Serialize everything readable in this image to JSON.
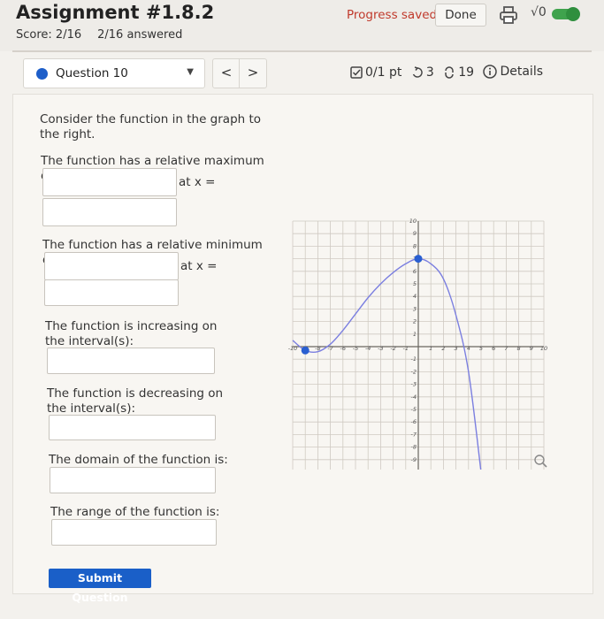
{
  "header": {
    "title": "Assignment #1.8.2",
    "score": "Score: 2/16",
    "answered": "2/16 answered",
    "progress_status": "Progress saved",
    "done_label": "Done",
    "sqrt_label": "√0"
  },
  "question_bar": {
    "question_label": "Question 10",
    "prev": "<",
    "next": ">",
    "points": "0/1 pt",
    "retries": "3",
    "attempts": "19",
    "details": "Details"
  },
  "question": {
    "intro": "Consider the function in the graph to the right.",
    "max_prompt": "The function has a relative maximum of",
    "max_at": "at x =",
    "min_prompt": "The function has a relative minimum of",
    "min_at": "at x =",
    "increasing_prompt": "The function is increasing on the interval(s):",
    "decreasing_prompt": "The function is decreasing on the interval(s):",
    "domain_prompt": "The domain of the function is:",
    "range_prompt": "The range of the function is:",
    "submit_label": "Submit Question"
  },
  "graph": {
    "x_range": [
      -10,
      10
    ],
    "y_range": [
      -10,
      10
    ],
    "x_ticks": [
      "-10",
      "-9",
      "-8",
      "-7",
      "-6",
      "-5",
      "-4",
      "-3",
      "-2",
      "-1",
      "1",
      "2",
      "3",
      "4",
      "5",
      "6",
      "7",
      "8",
      "9",
      "10"
    ],
    "y_ticks": [
      "10",
      "9",
      "8",
      "7",
      "6",
      "5",
      "4",
      "3",
      "2",
      "1",
      "-1",
      "-2",
      "-3",
      "-4",
      "-5",
      "-6",
      "-7",
      "-8",
      "-9",
      "-10"
    ],
    "curve_points": [
      [
        -10,
        0.5
      ],
      [
        -9,
        -0.3
      ],
      [
        -8,
        -0.4
      ],
      [
        -7,
        0.2
      ],
      [
        -6,
        1.3
      ],
      [
        -5,
        2.6
      ],
      [
        -4,
        3.9
      ],
      [
        -3,
        5.0
      ],
      [
        -2,
        5.9
      ],
      [
        -1,
        6.6
      ],
      [
        0,
        7
      ],
      [
        1,
        6.6
      ],
      [
        2,
        5.4
      ],
      [
        3,
        2.5
      ],
      [
        4,
        -2
      ],
      [
        5,
        -10
      ]
    ],
    "start_point": [
      -9,
      -0.3
    ],
    "max_point": [
      0,
      7
    ],
    "curve_color": "#7b7fe0",
    "point_color": "#2a5fd1",
    "zoom_icon": "magnifier-icon"
  }
}
